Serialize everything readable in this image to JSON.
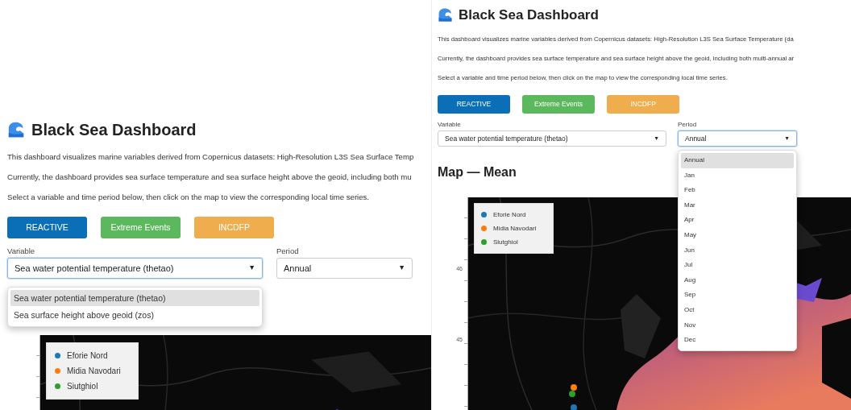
{
  "panels": [
    {
      "title": "Black Sea Dashboard",
      "paragraphs": [
        "This dashboard visualizes marine variables derived from Copernicus datasets: High-Resolution L3S Sea Surface Temp",
        "Currently, the dashboard provides sea surface temperature and sea surface height above the geoid, including both mu",
        "Select a variable and time period below, then click on the map to view the corresponding local time series."
      ],
      "buttons": [
        {
          "label": "REACTIVE",
          "color": "#0b6fb8"
        },
        {
          "label": "Extreme Events",
          "color": "#5cb85c"
        },
        {
          "label": "INCDFP",
          "color": "#f0ad4e"
        }
      ],
      "fields": [
        {
          "label": "Variable",
          "value": "Sea water potential temperature (thetao)",
          "caret": "▼",
          "open": true,
          "options": [
            {
              "label": "Sea water potential temperature (thetao)",
              "selected": true
            },
            {
              "label": "Sea surface height above geoid (zos)",
              "selected": false
            }
          ]
        },
        {
          "label": "Period",
          "value": "Annual",
          "caret": "▼",
          "open": false
        }
      ],
      "map": {
        "legend": [
          {
            "label": "Eforie Nord",
            "color": "#1f77b4"
          },
          {
            "label": "Midia Navodari",
            "color": "#ff7f0e"
          },
          {
            "label": "Siutghiol",
            "color": "#2ca02c"
          }
        ]
      }
    },
    {
      "title": "Black Sea Dashboard",
      "paragraphs": [
        "This dashboard visualizes marine variables derived from Copernicus datasets: High-Resolution L3S Sea Surface Temperature (da",
        "Currently, the dashboard provides sea surface temperature and sea surface height above the geoid, including both multi-annual ar",
        "Select a variable and time period below, then click on the map to view the corresponding local time series."
      ],
      "buttons": [
        {
          "label": "REACTIVE",
          "color": "#0b6fb8"
        },
        {
          "label": "Extreme Events",
          "color": "#5cb85c"
        },
        {
          "label": "INCDFP",
          "color": "#f0ad4e"
        }
      ],
      "fields": [
        {
          "label": "Variable",
          "value": "Sea water potential temperature (thetao)",
          "caret": "▼",
          "open": false
        },
        {
          "label": "Period",
          "value": "Annual",
          "caret": "▼",
          "open": true,
          "options": [
            {
              "label": "Annual",
              "selected": true
            },
            {
              "label": "Jan",
              "selected": false
            },
            {
              "label": "Feb",
              "selected": false
            },
            {
              "label": "Mar",
              "selected": false
            },
            {
              "label": "Apr",
              "selected": false
            },
            {
              "label": "May",
              "selected": false
            },
            {
              "label": "Jun",
              "selected": false
            },
            {
              "label": "Jul",
              "selected": false
            },
            {
              "label": "Aug",
              "selected": false
            },
            {
              "label": "Sep",
              "selected": false
            },
            {
              "label": "Oct",
              "selected": false
            },
            {
              "label": "Nov",
              "selected": false
            },
            {
              "label": "Dec",
              "selected": false
            }
          ]
        }
      ],
      "map_heading": "Map — Mean",
      "map": {
        "y_ticks": [
          "46",
          "45"
        ],
        "legend": [
          {
            "label": "Eforie Nord",
            "color": "#1f77b4"
          },
          {
            "label": "Midia Navodari",
            "color": "#ff7f0e"
          },
          {
            "label": "Siutghiol",
            "color": "#2ca02c"
          }
        ],
        "stations": [
          {
            "color": "#ff7f0e"
          },
          {
            "color": "#2ca02c"
          },
          {
            "color": "#1f77b4"
          }
        ]
      }
    }
  ]
}
